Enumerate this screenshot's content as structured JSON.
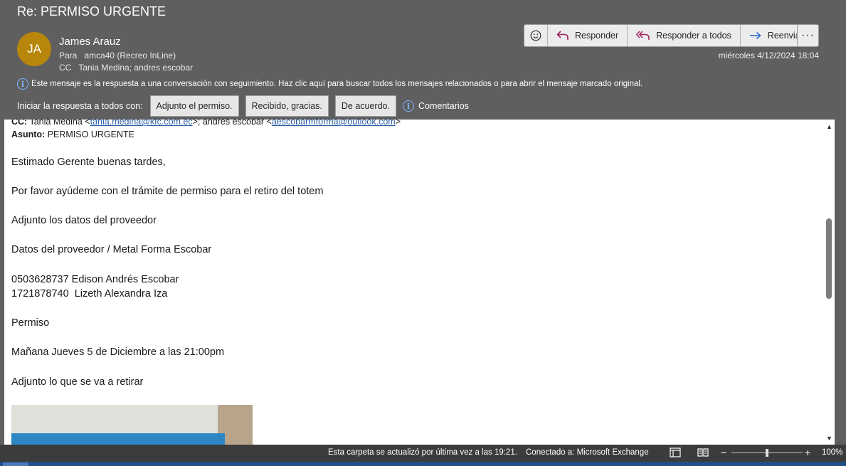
{
  "email": {
    "subject": "Re: PERMISO URGENTE",
    "sender_initials": "JA",
    "sender_name": "James Arauz",
    "to_label": "Para",
    "to_value": "amca40 (Recreo InLine)",
    "cc_label": "CC",
    "cc_value": "Tania Medina; andres escobar",
    "date": "miércoles 4/12/2024 18:04"
  },
  "actions": {
    "reply": "Responder",
    "reply_all": "Responder a todos",
    "forward": "Reenviar",
    "more": "···"
  },
  "info_bar": {
    "text": "Este mensaje es la respuesta a una conversación con seguimiento. Haz clic aquí para buscar todos los mensajes relacionados o para abrir el mensaje marcado original."
  },
  "quick_replies": {
    "label": "Iniciar la respuesta a todos con:",
    "options": [
      "Adjunto el permiso.",
      "Recibido, gracias.",
      "De acuerdo."
    ],
    "comments": "Comentarios"
  },
  "body": {
    "cc_label": "CC:",
    "cc_name1": "Tania Medina <",
    "cc_email1": "tania.medina@kfc.com.ec",
    "cc_sep": ">; andres escobar <",
    "cc_email2": "aescobarmforma@outlook.com",
    "cc_end": ">",
    "subject_label": "Asunto:",
    "subject_value": "PERMISO URGENTE",
    "lines": [
      "Estimado Gerente buenas tardes,",
      "Por favor ayúdeme con el trámite de permiso para el retiro del totem",
      "Adjunto los datos del proveedor",
      "Datos del proveedor / Metal Forma Escobar",
      "0503628737 Edison Andrés Escobar",
      "1721878740  Lizeth Alexandra Iza",
      "Permiso",
      "Mañana Jueves 5 de Diciembre a las 21:00pm",
      "Adjunto lo que se va a retirar"
    ]
  },
  "statusbar": {
    "updated": "Esta carpeta se actualizó por última vez a las 19:21.",
    "connection": "Conectado a: Microsoft Exchange",
    "zoom": "100%",
    "zoom_level_fraction": 0.5
  },
  "colors": {
    "header_bg": "#5f5f5f",
    "avatar_bg": "#b8860b",
    "reply_icon": "#a0245c",
    "forward_icon": "#2a6fcf",
    "info_icon": "#7fb4ff",
    "link": "#2a5ea8"
  }
}
